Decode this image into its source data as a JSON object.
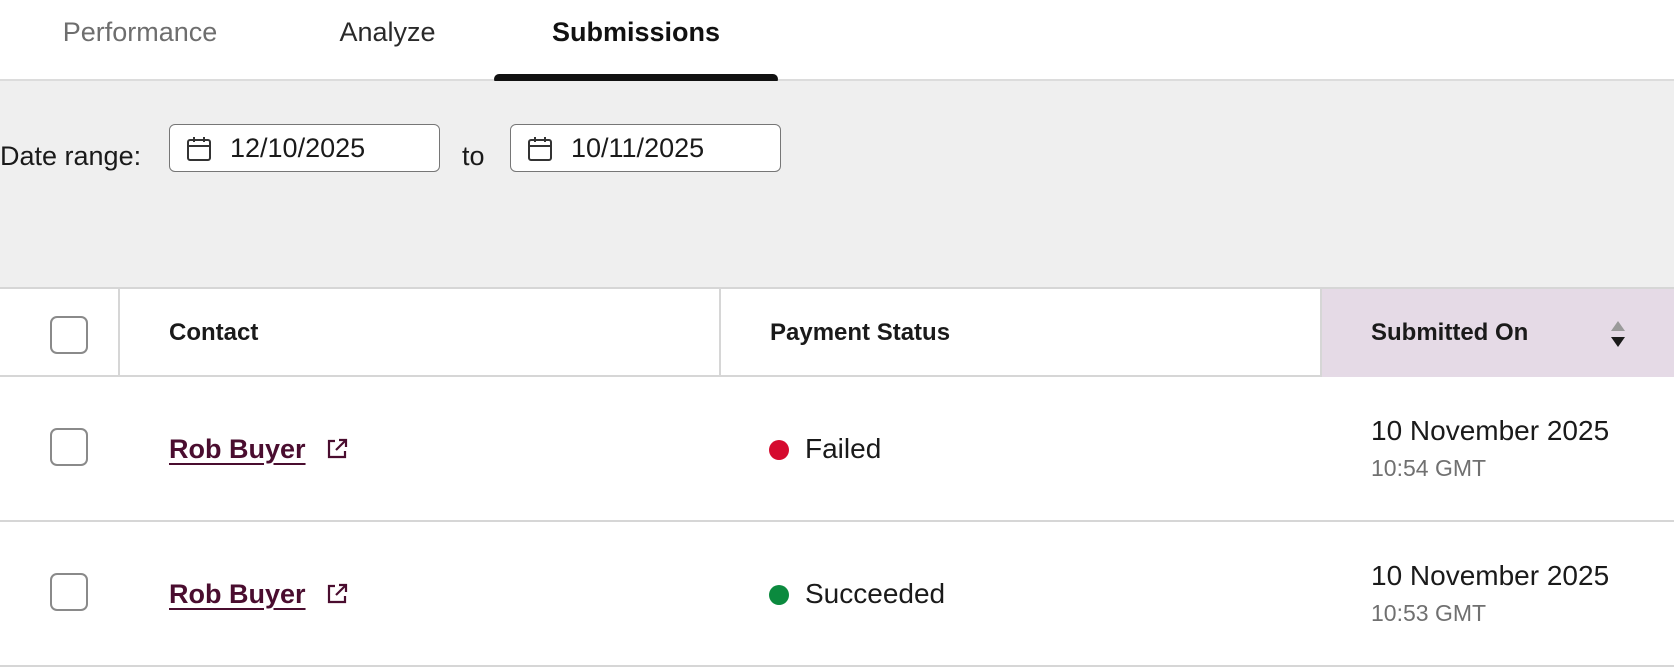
{
  "tabs": [
    {
      "label": "Performance"
    },
    {
      "label": "Analyze"
    },
    {
      "label": "Submissions",
      "active": true
    }
  ],
  "filter": {
    "label": "Date range:",
    "from": "12/10/2025",
    "separator": "to",
    "to": "10/11/2025"
  },
  "table": {
    "headers": {
      "contact": "Contact",
      "payment_status": "Payment Status",
      "submitted_on": "Submitted On"
    },
    "rows": [
      {
        "contact": "Rob Buyer",
        "status": "Failed",
        "status_color": "#d50b2f",
        "date": "10 November 2025",
        "time": "10:54 GMT"
      },
      {
        "contact": "Rob Buyer",
        "status": "Succeeded",
        "status_color": "#0b8a3e",
        "date": "10 November 2025",
        "time": "10:53 GMT"
      }
    ]
  },
  "colors": {
    "link": "#4a0d2f",
    "sorted_header_bg": "#e5dae6",
    "filter_bg": "#efefef"
  }
}
